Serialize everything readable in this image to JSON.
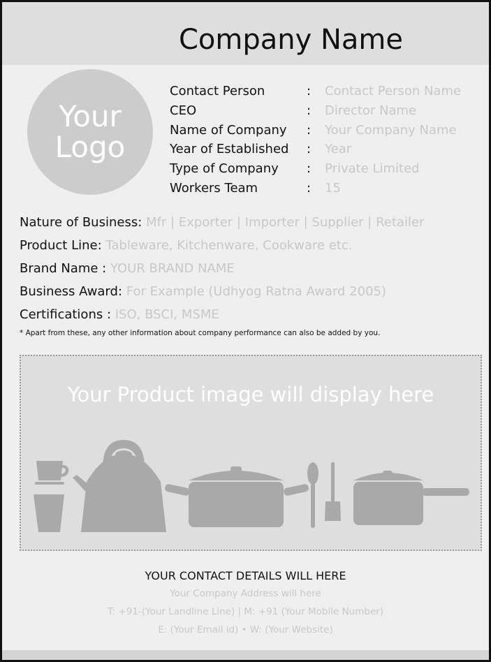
{
  "header": {
    "company_name": "Company Name"
  },
  "logo": {
    "line1": "Your",
    "line2": "Logo"
  },
  "info": [
    {
      "label": "Contact Person",
      "value": "Contact Person Name"
    },
    {
      "label": "CEO",
      "value": "Director Name"
    },
    {
      "label": "Name of Company",
      "value": "Your Company Name"
    },
    {
      "label": "Year of Established",
      "value": "Year"
    },
    {
      "label": "Type of Company",
      "value": "Private Limited"
    },
    {
      "label": "Workers Team",
      "value": "15"
    }
  ],
  "info_separator": ":",
  "details": [
    {
      "label": "Nature of Business:",
      "value": "Mfr |  Exporter |  Importer | Supplier | Retailer"
    },
    {
      "label": "Product Line:",
      "value": "Tableware, Kitchenware, Cookware etc."
    },
    {
      "label": "Brand Name :",
      "value": "YOUR BRAND NAME"
    },
    {
      "label": "Business Award:",
      "value": "For Example (Udhyog Ratna Award 2005)"
    },
    {
      "label": "Certifications :",
      "value": "ISO, BSCI, MSME"
    }
  ],
  "note": "* Apart from these, any other information about company performance can also be added by you.",
  "product": {
    "placeholder": "Your Product image will display here",
    "icons": [
      "cup-icon",
      "glass-icon",
      "kettle-icon",
      "pot-icon",
      "spoon-icon",
      "spatula-icon",
      "saucepan-icon"
    ]
  },
  "contact": {
    "title": "YOUR CONTACT DETAILS WILL HERE",
    "address": "Your Company Address will here",
    "phones": "T: +91-(Your Landline Line) | M: +91 (Your Mobile Number)",
    "web": "E: (Your Email id)  • W: (Your Website)"
  },
  "colors": {
    "header_bg": "#dedede",
    "page_bg": "#efefef",
    "placeholder_text": "#c8c8c8",
    "logo_bg": "#cccccc",
    "illustration": "#a9a9a9"
  }
}
